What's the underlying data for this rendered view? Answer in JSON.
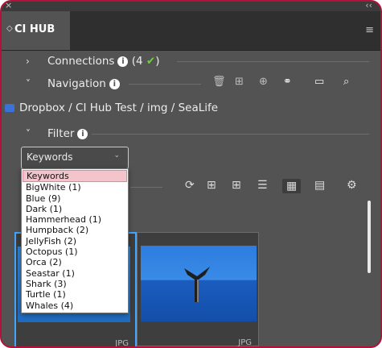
{
  "window": {
    "close_glyph": "×",
    "collapse_glyph": "‹‹"
  },
  "panel": {
    "tab_title": "CI HUB",
    "menu_icon": "hamburger-icon"
  },
  "connections": {
    "label": "Connections",
    "count": "(4",
    "check": "✔",
    "close_paren": ")"
  },
  "navigation": {
    "label": "Navigation",
    "icons": [
      "trash-icon",
      "plus-box-icon",
      "zoom-icon",
      "link-icon",
      "folder-icon",
      "search-icon"
    ]
  },
  "path": {
    "text": "Dropbox / CI Hub Test / img / SeaLife"
  },
  "filter": {
    "label": "Filter",
    "select_value": "Keywords",
    "options": [
      "Keywords",
      "BigWhite (1)",
      "Blue (9)",
      "Dark (1)",
      "Hammerhead (1)",
      "Humpback (2)",
      "JellyFish (2)",
      "Octopus (1)",
      "Orca (2)",
      "Seastar (1)",
      "Shark (3)",
      "Turtle (1)",
      "Whales (4)"
    ],
    "highlighted_index": 0
  },
  "toolbar": {
    "icons": [
      "refresh-icon",
      "grid-small-icon",
      "grid-plus-icon",
      "list-icon",
      "grid-large-icon",
      "card-icon",
      "settings-icon"
    ],
    "active": "grid-large-icon"
  },
  "thumbnails": [
    {
      "type": "JPG",
      "selected": true
    },
    {
      "type": "JPG",
      "selected": false
    }
  ],
  "colors": {
    "accent": "#41a6ff",
    "frame": "#b0123a",
    "panel": "#535353",
    "highlight": "#f3c4cc"
  }
}
